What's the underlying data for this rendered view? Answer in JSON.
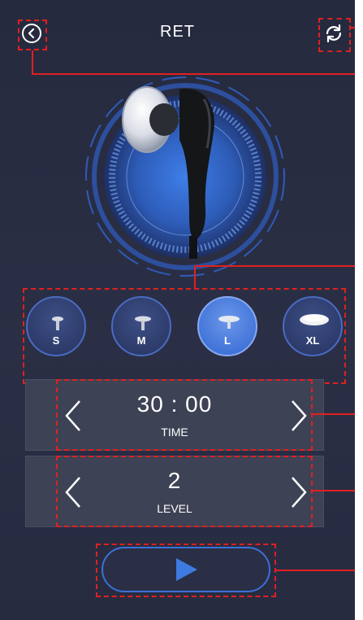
{
  "header": {
    "title": "RET",
    "back_icon": "chevron-left-circle-icon",
    "refresh_icon": "refresh-icon"
  },
  "tips": [
    {
      "label": "S",
      "selected": false
    },
    {
      "label": "M",
      "selected": false
    },
    {
      "label": "L",
      "selected": true
    },
    {
      "label": "XL",
      "selected": false
    }
  ],
  "time": {
    "value": "30 : 00",
    "label": "TIME"
  },
  "level": {
    "value": "2",
    "label": "LEVEL"
  },
  "play": {
    "icon": "play-icon"
  },
  "colors": {
    "background": "#282c41",
    "accent": "#3d70d6",
    "annotation": "#e02020",
    "panel": "#3e4255"
  }
}
